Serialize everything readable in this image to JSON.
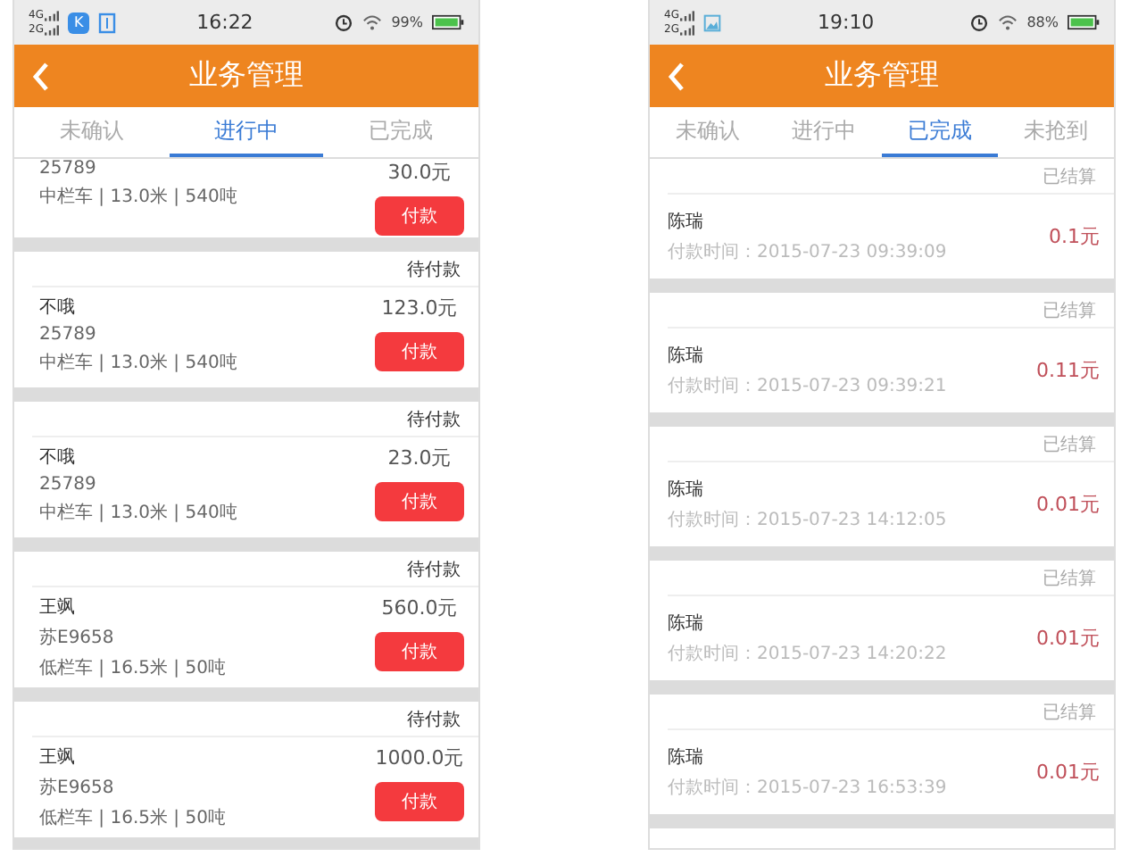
{
  "screens": [
    {
      "kind": "orders",
      "status_bar": {
        "network": [
          "4G",
          "2G"
        ],
        "notification_icons": [
          {
            "kind": "badge",
            "label": "K"
          },
          {
            "kind": "outline"
          }
        ],
        "time": "16:22",
        "battery": "99%"
      },
      "header": {
        "title": "业务管理"
      },
      "tabs": [
        {
          "label": "未确认",
          "selected": false
        },
        {
          "label": "进行中",
          "selected": true
        },
        {
          "label": "已完成",
          "selected": false
        }
      ],
      "items": [
        {
          "plate": "25789",
          "spec": "中栏车 | 13.0米 | 540吨",
          "price": "30.0元",
          "button": "付款"
        },
        {
          "status": "待付款",
          "name": "不哦",
          "plate": "25789",
          "spec": "中栏车 | 13.0米 | 540吨",
          "price": "123.0元",
          "button": "付款"
        },
        {
          "status": "待付款",
          "name": "不哦",
          "plate": "25789",
          "spec": "中栏车 | 13.0米 | 540吨",
          "price": "23.0元",
          "button": "付款"
        },
        {
          "status": "待付款",
          "name": "王飒",
          "plate": "苏E9658",
          "spec": "低栏车 | 16.5米 | 50吨",
          "price": "560.0元",
          "button": "付款"
        },
        {
          "status": "待付款",
          "name": "王飒",
          "plate": "苏E9658",
          "spec": "低栏车 | 16.5米 | 50吨",
          "price": "1000.0元",
          "button": "付款"
        }
      ]
    },
    {
      "kind": "settled",
      "status_bar": {
        "network": [
          "4G",
          "2G"
        ],
        "notification_icons": [
          {
            "kind": "image"
          }
        ],
        "time": "19:10",
        "battery": "88%"
      },
      "header": {
        "title": "业务管理"
      },
      "tabs": [
        {
          "label": "未确认",
          "selected": false
        },
        {
          "label": "进行中",
          "selected": false
        },
        {
          "label": "已完成",
          "selected": true
        },
        {
          "label": "未抢到",
          "selected": false
        }
      ],
      "items": [
        {
          "status": "已结算",
          "name": "陈瑞",
          "time": "付款时间：2015-07-23 09:39:09",
          "amount": "0.1元"
        },
        {
          "status": "已结算",
          "name": "陈瑞",
          "time": "付款时间：2015-07-23 09:39:21",
          "amount": "0.11元"
        },
        {
          "status": "已结算",
          "name": "陈瑞",
          "time": "付款时间：2015-07-23 14:12:05",
          "amount": "0.01元"
        },
        {
          "status": "已结算",
          "name": "陈瑞",
          "time": "付款时间：2015-07-23 14:20:22",
          "amount": "0.01元"
        },
        {
          "status": "已结算",
          "name": "陈瑞",
          "time": "付款时间：2015-07-23 16:53:39",
          "amount": "0.01元"
        }
      ]
    }
  ]
}
